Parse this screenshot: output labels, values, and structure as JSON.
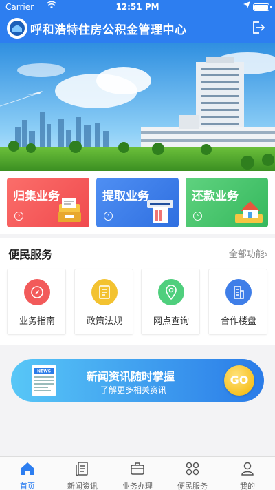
{
  "status_bar": {
    "carrier": "Carrier",
    "time": "12:51 PM"
  },
  "header": {
    "title": "呼和浩特住房公积金管理中心"
  },
  "business": [
    {
      "label": "归集业务",
      "color": "#f45b5c"
    },
    {
      "label": "提取业务",
      "color": "#3d7ff0"
    },
    {
      "label": "还款业务",
      "color": "#4cc46d"
    }
  ],
  "service": {
    "title": "便民服务",
    "more": "全部功能",
    "items": [
      {
        "label": "业务指南",
        "icon": "compass-icon",
        "color": "#f25a5a"
      },
      {
        "label": "政策法规",
        "icon": "document-icon",
        "color": "#f3c230"
      },
      {
        "label": "网点查询",
        "icon": "location-pin-icon",
        "color": "#4fcf7d"
      },
      {
        "label": "合作楼盘",
        "icon": "building-icon",
        "color": "#3f7ee8"
      }
    ]
  },
  "news_banner": {
    "title": "新闻资讯随时掌握",
    "subtitle": "了解更多相关资讯",
    "go_label": "GO",
    "paper_label": "NEWS"
  },
  "tabs": [
    {
      "label": "首页",
      "icon": "home-icon",
      "active": true
    },
    {
      "label": "新闻资讯",
      "icon": "news-icon",
      "active": false
    },
    {
      "label": "业务办理",
      "icon": "briefcase-icon",
      "active": false
    },
    {
      "label": "便民服务",
      "icon": "grid-icon",
      "active": false
    },
    {
      "label": "我的",
      "icon": "person-icon",
      "active": false
    }
  ],
  "colors": {
    "primary": "#2d7ef0",
    "active_tab": "#2d7ef0"
  }
}
